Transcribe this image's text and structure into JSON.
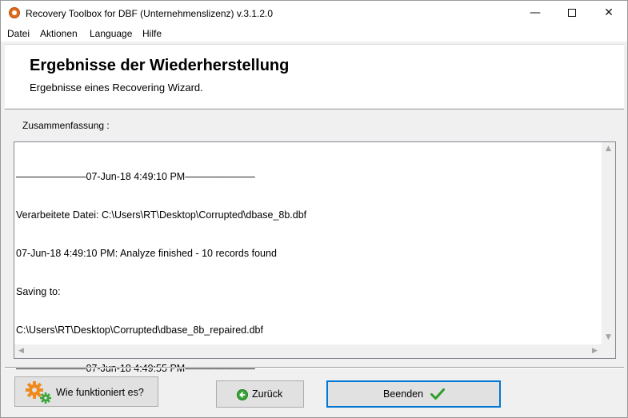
{
  "window": {
    "title": "Recovery Toolbox for DBF (Unternehmenslizenz) v.3.1.2.0",
    "minimize_glyph": "—",
    "close_glyph": "✕"
  },
  "menu": [
    "Datei",
    "Aktionen",
    "Language",
    "Hilfe"
  ],
  "header": {
    "title": "Ergebnisse der Wiederherstellung",
    "subtitle": "Ergebnisse eines Recovering Wizard."
  },
  "summary": {
    "label": "Zusammenfassung :",
    "lines": [
      "―――――――07-Jun-18 4:49:10 PM―――――――",
      "Verarbeitete Datei: C:\\Users\\RT\\Desktop\\Corrupted\\dbase_8b.dbf",
      "07-Jun-18 4:49:10 PM: Analyze finished - 10 records found",
      "Saving to:",
      "C:\\Users\\RT\\Desktop\\Corrupted\\dbase_8b_repaired.dbf",
      "―――――――07-Jun-18 4:49:55 PM―――――――"
    ]
  },
  "scroll_glyphs": {
    "up": "▲",
    "down": "▼",
    "left": "◀",
    "right": "▶"
  },
  "buttons": {
    "how_it_works": "Wie funktioniert es?",
    "back": "Zurück",
    "finish": "Beenden"
  },
  "icons": {
    "app": "recovery-toolbox-icon",
    "how": "gears-icon",
    "back": "green-back-arrow-icon",
    "finish": "green-checkmark-icon"
  },
  "colors": {
    "finish_border": "#0078d7",
    "gear_orange": "#f08a1c",
    "gear_green": "#3aa53a",
    "check_green": "#2a9d2a"
  }
}
